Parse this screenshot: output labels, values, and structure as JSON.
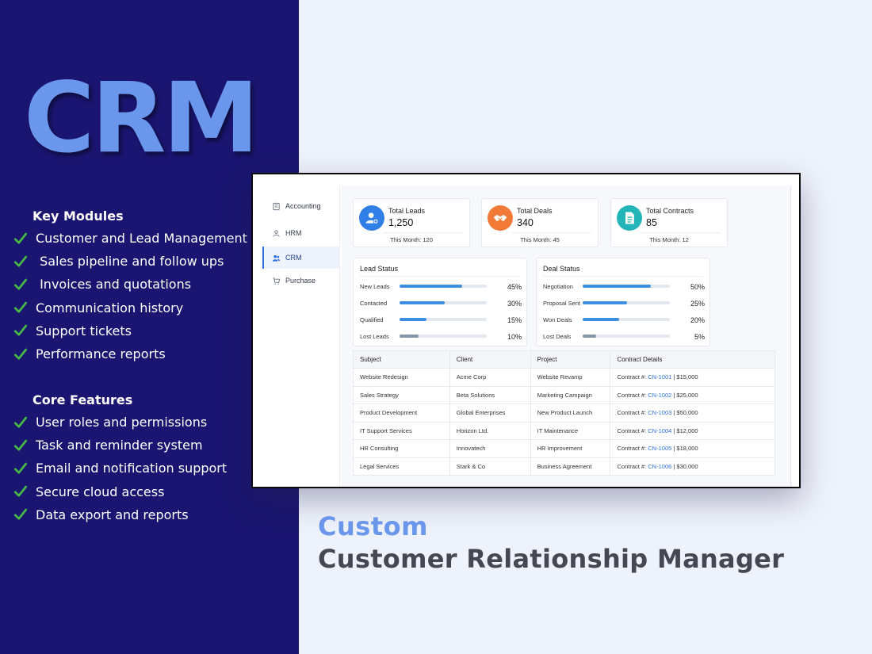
{
  "hero": {
    "logo_text": "CRM"
  },
  "key_modules": {
    "heading": "Key Modules",
    "items": [
      "Customer and Lead Management",
      " Sales pipeline and follow ups",
      " Invoices and quotations",
      "Communication history",
      "Support tickets",
      "Performance reports"
    ]
  },
  "core_features": {
    "heading": "Core Features",
    "items": [
      "User roles and permissions",
      "Task and reminder system",
      "Email and notification support",
      "Secure cloud access",
      "Data export and reports"
    ]
  },
  "footer": {
    "title": "Custom",
    "subtitle": "Customer Relationship Manager"
  },
  "colors": {
    "panel_bg": "#1a1570",
    "logo_blue": "#6a96ec",
    "check_green": "#46b845",
    "bar_blue": "#3d8fe0"
  },
  "dashboard": {
    "sidebar": [
      {
        "label": "Accounting",
        "icon": "accounting-icon"
      },
      {
        "label": "HRM",
        "icon": "user-icon"
      },
      {
        "label": "CRM",
        "icon": "users-icon",
        "active": true
      },
      {
        "label": "Purchase",
        "icon": "cart-icon"
      }
    ],
    "stats": [
      {
        "label": "Total Leads",
        "value": "1,250",
        "month": "This Month: 120",
        "icon": "user-add-icon"
      },
      {
        "label": "Total Deals",
        "value": "340",
        "month": "This Month: 45",
        "icon": "handshake-icon"
      },
      {
        "label": "Total Contracts",
        "value": "85",
        "month": "This Month:  12",
        "icon": "document-icon"
      }
    ],
    "lead_status": {
      "title": "Lead Status",
      "rows": [
        {
          "label": "New Leads",
          "pct": "45%",
          "value": 0.72
        },
        {
          "label": "Contacted",
          "pct": "30%",
          "value": 0.52
        },
        {
          "label": "Qualified",
          "pct": "15%",
          "value": 0.31
        },
        {
          "label": "Lost Leads",
          "pct": "10%",
          "value": 0.22,
          "grey": true
        }
      ]
    },
    "deal_status": {
      "title": "Deal Status",
      "rows": [
        {
          "label": "Negotiation",
          "pct": "50%",
          "value": 0.78
        },
        {
          "label": "Proposal Sent",
          "pct": "25%",
          "value": 0.51
        },
        {
          "label": "Won Deals",
          "pct": "20%",
          "value": 0.42
        },
        {
          "label": "Lost Deals",
          "pct": "5%",
          "value": 0.15,
          "grey": true
        }
      ]
    },
    "table": {
      "headers": [
        "Subject",
        "Client",
        "Project",
        "Contract Details"
      ],
      "contract_prefix": "Contract #:",
      "rows": [
        {
          "subject": "Website Redesign",
          "client": "Acme Corp",
          "project": "Website Revamp",
          "cn": "CN-1001",
          "amount": "| $15,000"
        },
        {
          "subject": "Sales Strategy",
          "client": "Beta Solutions",
          "project": "Marketing Campaign",
          "cn": "CN-1002",
          "amount": "| $25,000"
        },
        {
          "subject": "Product Development",
          "client": "Global Enterprises",
          "project": "New Product Launch",
          "cn": "CN-1003",
          "amount": "| $50,000"
        },
        {
          "subject": "IT Support Services",
          "client": "Horizon Ltd.",
          "project": "IT Maintenance",
          "cn": "CN-1004",
          "amount": "| $12,000"
        },
        {
          "subject": "HR Consulting",
          "client": "Innovatech",
          "project": "HR Improvement",
          "cn": "CN-1005",
          "amount": "| $18,000"
        },
        {
          "subject": "Legal Services",
          "client": "Stark & Co",
          "project": "Business Agreement",
          "cn": "CN-1006",
          "amount": "| $30,000"
        }
      ]
    }
  }
}
